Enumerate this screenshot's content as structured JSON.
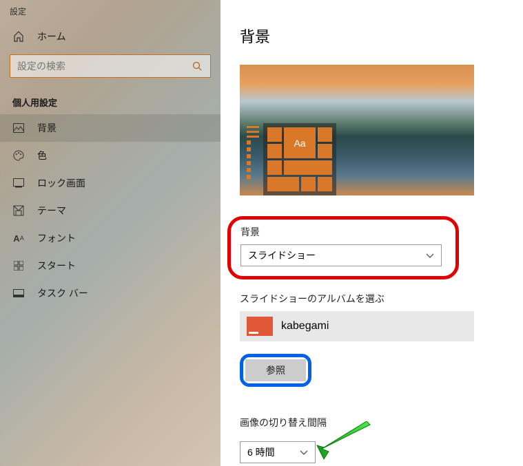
{
  "app_title": "設定",
  "home_label": "ホーム",
  "search": {
    "placeholder": "設定の検索"
  },
  "category_title": "個人用設定",
  "sidebar": {
    "items": [
      {
        "label": "背景"
      },
      {
        "label": "色"
      },
      {
        "label": "ロック画面"
      },
      {
        "label": "テーマ"
      },
      {
        "label": "フォント"
      },
      {
        "label": "スタート"
      },
      {
        "label": "タスク バー"
      }
    ]
  },
  "page": {
    "title": "背景",
    "preview_sample": "Aa",
    "background_section": {
      "label": "背景",
      "value": "スライドショー"
    },
    "album_section": {
      "label": "スライドショーのアルバムを選ぶ",
      "folder_name": "kabegami",
      "browse_label": "参照"
    },
    "interval_section": {
      "label": "画像の切り替え間隔",
      "value": "6 時間"
    }
  }
}
